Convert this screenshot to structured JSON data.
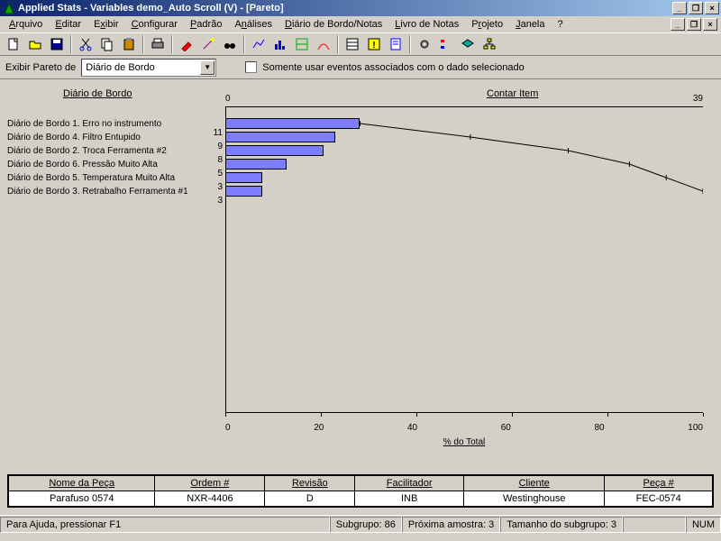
{
  "title": "Applied Stats - Variables demo_Auto Scroll (V) - [Pareto]",
  "menu": {
    "arquivo": "Arquivo",
    "editar": "Editar",
    "exibir": "Exibir",
    "configurar": "Configurar",
    "padrao": "Padrão",
    "analises": "Análises",
    "diario": "Diário de Bordo/Notas",
    "livro": "Livro de Notas",
    "projeto": "Projeto",
    "janela": "Janela",
    "help": "?"
  },
  "controlbar": {
    "label": "Exibir Pareto de",
    "dropdown": "Diário de Bordo",
    "checkbox_label": "Somente usar eventos associados com o dado selecionado"
  },
  "chart_data": {
    "type": "bar",
    "left_title": "Diário de Bordo",
    "right_title": "Contar Item",
    "xlabel": "% do Total",
    "x_ticks": [
      "0",
      "20",
      "40",
      "60",
      "80",
      "100"
    ],
    "top_left": "0",
    "top_right": "39",
    "items": [
      {
        "label": "Diário de Bordo 1.  Erro no instrumento",
        "value": 11,
        "pct": 28.2
      },
      {
        "label": "Diário de Bordo 4.  Filtro Entupido",
        "value": 9,
        "pct": 23.1
      },
      {
        "label": "Diário de Bordo 2.  Troca Ferramenta #2",
        "value": 8,
        "pct": 20.5
      },
      {
        "label": "Diário de Bordo 6.  Pressão Muito Alta",
        "value": 5,
        "pct": 12.8
      },
      {
        "label": "Diário de Bordo 5.  Temperatura Muito Alta",
        "value": 3,
        "pct": 7.7
      },
      {
        "label": "Diário de Bordo 3.  Retrabalho Ferramenta #1",
        "value": 3,
        "pct": 7.7
      }
    ],
    "cumulative": [
      28.2,
      51.3,
      71.8,
      84.6,
      92.3,
      100
    ]
  },
  "info_table": {
    "headers": [
      "Nome da Peça",
      "Ordem #",
      "Revisão",
      "Facilitador",
      "Cliente",
      "Peça #"
    ],
    "row": [
      "Parafuso 0574",
      "NXR-4406",
      "D",
      "INB",
      "Westinghouse",
      "FEC-0574"
    ]
  },
  "status": {
    "help": "Para Ajuda, pressionar F1",
    "subgrupo": "Subgrupo: 86",
    "proxima": "Próxima amostra: 3",
    "tamanho": "Tamanho do subgrupo: 3",
    "num": "NUM"
  }
}
